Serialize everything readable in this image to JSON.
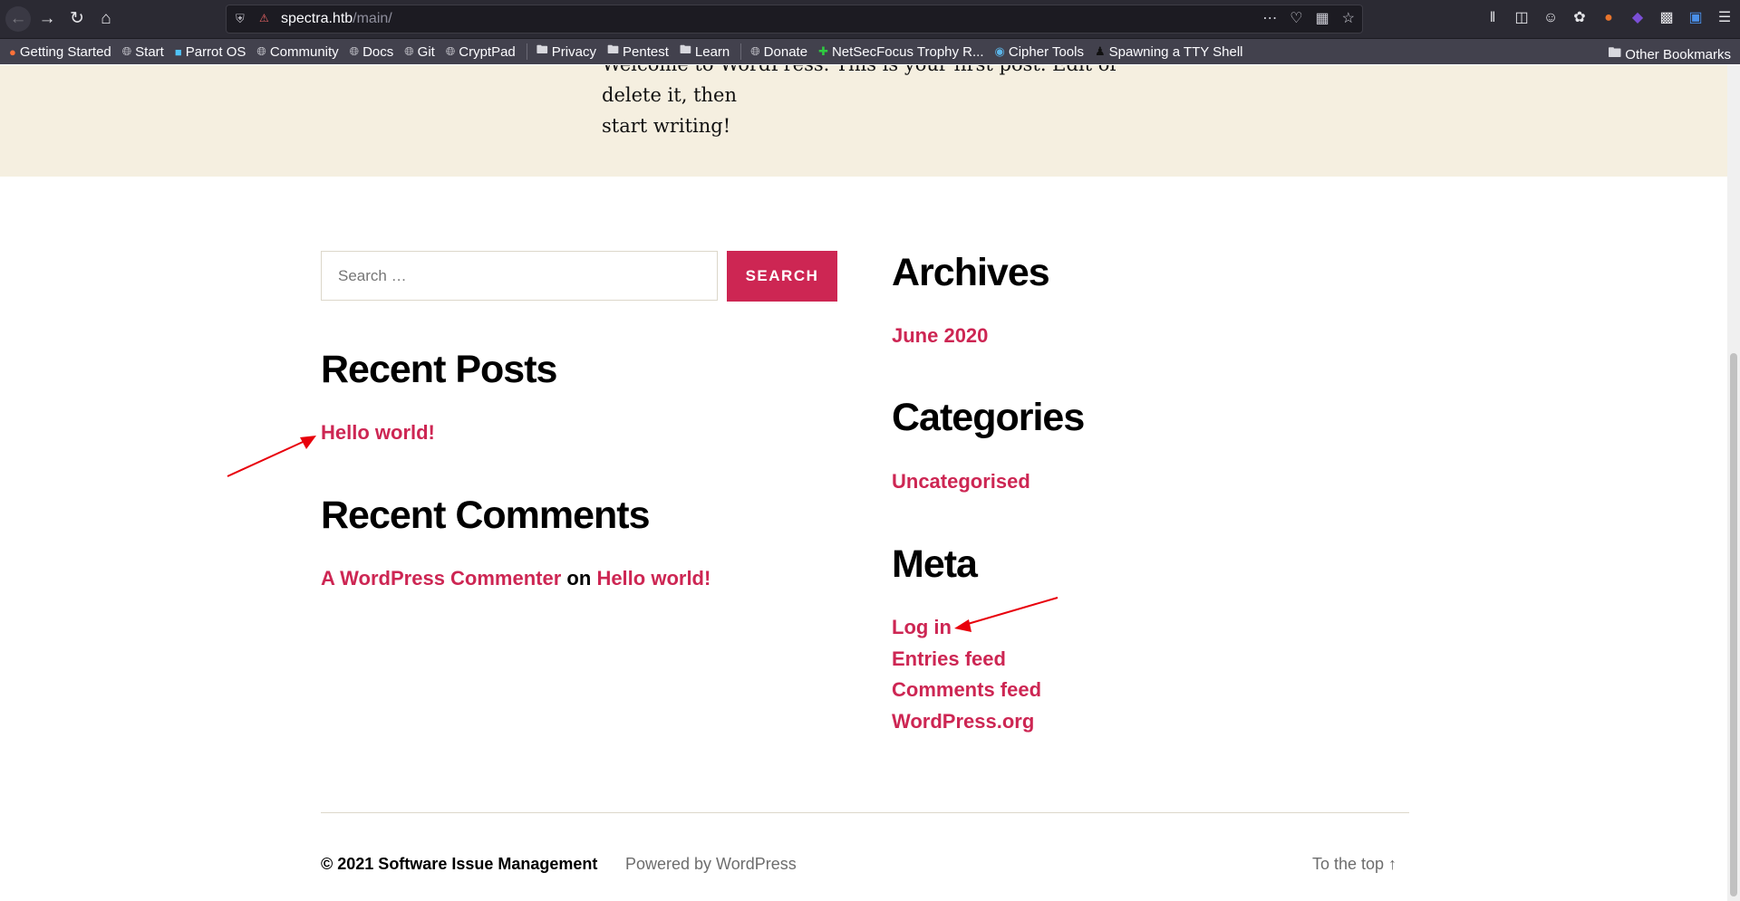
{
  "browser": {
    "url_host": "spectra.htb",
    "url_path": "/main/"
  },
  "bookmarks": [
    {
      "label": "Getting Started"
    },
    {
      "label": "Start"
    },
    {
      "label": "Parrot OS"
    },
    {
      "label": "Community"
    },
    {
      "label": "Docs"
    },
    {
      "label": "Git"
    },
    {
      "label": "CryptPad"
    },
    {
      "label": "Privacy"
    },
    {
      "label": "Pentest"
    },
    {
      "label": "Learn"
    },
    {
      "label": "Donate"
    },
    {
      "label": "NetSecFocus Trophy R..."
    },
    {
      "label": "Cipher Tools"
    },
    {
      "label": "Spawning a TTY Shell"
    }
  ],
  "other_bookmarks": "Other Bookmarks",
  "page": {
    "entry_text_line1": "Welcome to WordPress. This is your first post. Edit or delete it, then",
    "entry_text_line2": "start writing!",
    "search": {
      "placeholder": "Search …",
      "button": "SEARCH"
    },
    "recent_posts": {
      "title": "Recent Posts",
      "items": [
        "Hello world!"
      ]
    },
    "recent_comments": {
      "title": "Recent Comments",
      "author": "A WordPress Commenter",
      "on": "on",
      "post": "Hello world!"
    },
    "archives": {
      "title": "Archives",
      "items": [
        "June 2020"
      ]
    },
    "categories": {
      "title": "Categories",
      "items": [
        "Uncategorised"
      ]
    },
    "meta": {
      "title": "Meta",
      "items": [
        "Log in",
        "Entries feed",
        "Comments feed",
        "WordPress.org"
      ]
    },
    "footer": {
      "copyright": "© 2021 Software Issue Management",
      "powered": "Powered by WordPress",
      "to_top": "To the top ↑"
    }
  },
  "colors": {
    "accent": "#cd2653",
    "band": "#f5efe0",
    "annotation_arrow": "#e8000b"
  }
}
